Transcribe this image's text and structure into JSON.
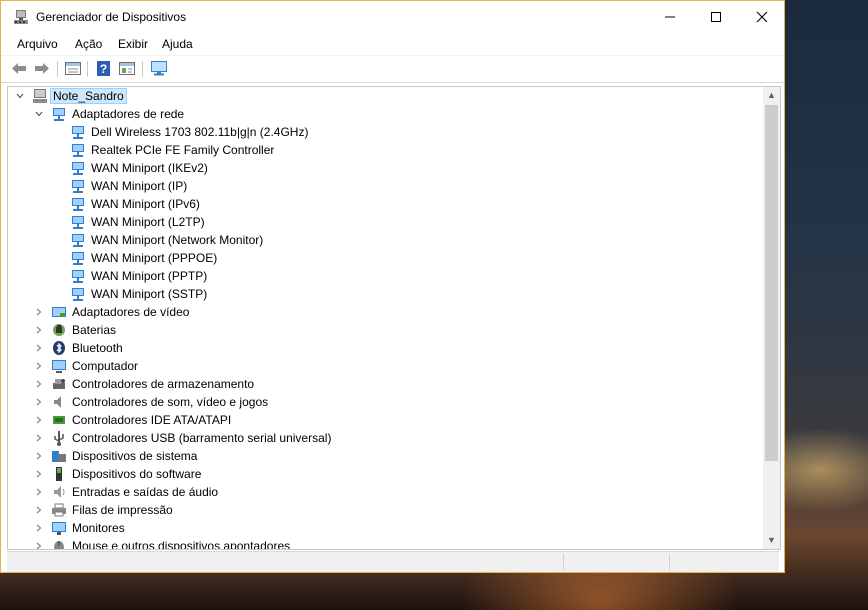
{
  "window": {
    "title": "Gerenciador de Dispositivos",
    "controls": {
      "minimize": "—",
      "maximize": "☐",
      "close": "✕"
    }
  },
  "menu": [
    "Arquivo",
    "Ação",
    "Exibir",
    "Ajuda"
  ],
  "toolbar": {
    "buttons": [
      "back-arrow-icon",
      "forward-arrow-icon",
      "show-hide-tree-icon",
      "help-icon",
      "properties-icon",
      "scan-hardware-icon"
    ]
  },
  "tree": {
    "root": "Note_Sandro",
    "network_category": "Adaptadores de rede",
    "network_adapters": [
      "Dell Wireless 1703 802.11b|g|n (2.4GHz)",
      "Realtek PCIe FE Family Controller",
      "WAN Miniport (IKEv2)",
      "WAN Miniport (IP)",
      "WAN Miniport (IPv6)",
      "WAN Miniport (L2TP)",
      "WAN Miniport (Network Monitor)",
      "WAN Miniport (PPPOE)",
      "WAN Miniport (PPTP)",
      "WAN Miniport (SSTP)"
    ],
    "categories": [
      {
        "label": "Adaptadores de vídeo",
        "icon": "display-adapter-icon"
      },
      {
        "label": "Baterias",
        "icon": "battery-icon"
      },
      {
        "label": "Bluetooth",
        "icon": "bluetooth-icon"
      },
      {
        "label": "Computador",
        "icon": "computer-icon"
      },
      {
        "label": "Controladores de armazenamento",
        "icon": "storage-controller-icon"
      },
      {
        "label": "Controladores de som, vídeo e jogos",
        "icon": "speaker-icon"
      },
      {
        "label": "Controladores IDE ATA/ATAPI",
        "icon": "ide-controller-icon"
      },
      {
        "label": "Controladores USB (barramento serial universal)",
        "icon": "usb-icon"
      },
      {
        "label": "Dispositivos de sistema",
        "icon": "system-device-icon"
      },
      {
        "label": "Dispositivos do software",
        "icon": "software-device-icon"
      },
      {
        "label": "Entradas e saídas de áudio",
        "icon": "audio-io-icon"
      },
      {
        "label": "Filas de impressão",
        "icon": "printer-icon"
      },
      {
        "label": "Monitores",
        "icon": "monitor-icon"
      },
      {
        "label": "Mouse e outros dispositivos apontadores",
        "icon": "mouse-icon"
      }
    ]
  },
  "colors": {
    "window_border": "#e6b24a",
    "selection": "#cce8ff",
    "network_icon": "#2f7fd0"
  }
}
